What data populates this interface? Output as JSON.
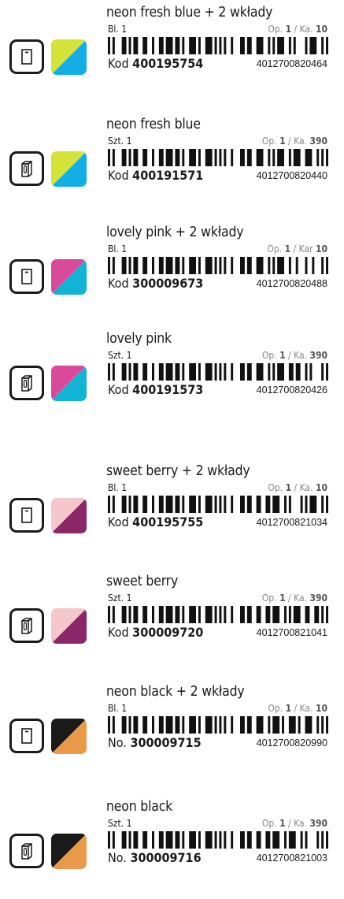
{
  "products": [
    {
      "name": "neon fresh blue + 2 wkłady",
      "unit": "Bl. 1",
      "pack_prefix": "Op.",
      "pack_op": "1",
      "pack_sep": "/",
      "pack_ka_label": "Ka.",
      "pack_ka": "10",
      "code_label": "Kod",
      "code": "400195754",
      "ean": "4012700820464",
      "pack_icon": "refill-card-icon",
      "swatch": {
        "top_left": "#d4e23a",
        "bottom_right": "#13aee6"
      }
    },
    {
      "name": "neon fresh blue",
      "unit": "Szt. 1",
      "pack_prefix": "Op.",
      "pack_op": "1",
      "pack_sep": "/",
      "pack_ka_label": "Ka.",
      "pack_ka": "390",
      "code_label": "Kod",
      "code": "400191571",
      "ean": "4012700820440",
      "pack_icon": "single-item-box-icon",
      "swatch": {
        "top_left": "#d4e23a",
        "bottom_right": "#13aee6"
      }
    },
    {
      "name": "lovely pink + 2 wkłady",
      "unit": "Bl. 1",
      "pack_prefix": "Op.",
      "pack_op": "1",
      "pack_sep": "/",
      "pack_ka_label": "Kar",
      "pack_ka": "10",
      "code_label": "Kod",
      "code": "300009673",
      "ean": "4012700820488",
      "pack_icon": "refill-card-icon",
      "swatch": {
        "top_left": "#d94a9a",
        "bottom_right": "#12b4d6"
      }
    },
    {
      "name": "lovely pink",
      "unit": "Szt. 1",
      "pack_prefix": "Op.",
      "pack_op": "1",
      "pack_sep": "/",
      "pack_ka_label": "Ka.",
      "pack_ka": "390",
      "code_label": "Kod",
      "code": "400191573",
      "ean": "4012700820426",
      "pack_icon": "single-item-box-icon",
      "swatch": {
        "top_left": "#d94a9a",
        "bottom_right": "#12b4d6"
      }
    },
    {
      "name": "sweet berry + 2 wkłady",
      "unit": "Bl. 1",
      "pack_prefix": "Op.",
      "pack_op": "1",
      "pack_sep": "/",
      "pack_ka_label": "Ka.",
      "pack_ka": "10",
      "code_label": "Kod",
      "code": "400195755",
      "ean": "4012700821034",
      "pack_icon": "refill-card-icon",
      "swatch": {
        "top_left": "#f4c7cc",
        "bottom_right": "#8b2767"
      }
    },
    {
      "name": "sweet berry",
      "unit": "Szt. 1",
      "pack_prefix": "Op.",
      "pack_op": "1",
      "pack_sep": "/",
      "pack_ka_label": "Ka.",
      "pack_ka": "390",
      "code_label": "Kod",
      "code": "300009720",
      "ean": "4012700821041",
      "pack_icon": "single-item-box-icon",
      "swatch": {
        "top_left": "#f4c7cc",
        "bottom_right": "#8b2767"
      }
    },
    {
      "name": "neon black + 2 wkłady",
      "unit": "Bl. 1",
      "pack_prefix": "Op.",
      "pack_op": "1",
      "pack_sep": "/",
      "pack_ka_label": "Ka.",
      "pack_ka": "10",
      "code_label": "No.",
      "code": "300009715",
      "ean": "4012700820990",
      "pack_icon": "refill-card-icon",
      "swatch": {
        "top_left": "#1a1a1a",
        "bottom_right": "#eb9a4a"
      }
    },
    {
      "name": "neon black",
      "unit": "Szt. 1",
      "pack_prefix": "Op.",
      "pack_op": "1",
      "pack_sep": "/",
      "pack_ka_label": "Ka.",
      "pack_ka": "390",
      "code_label": "No.",
      "code": "300009716",
      "ean": "4012700821003",
      "pack_icon": "single-item-box-icon",
      "swatch": {
        "top_left": "#1a1a1a",
        "bottom_right": "#eb9a4a"
      }
    }
  ]
}
